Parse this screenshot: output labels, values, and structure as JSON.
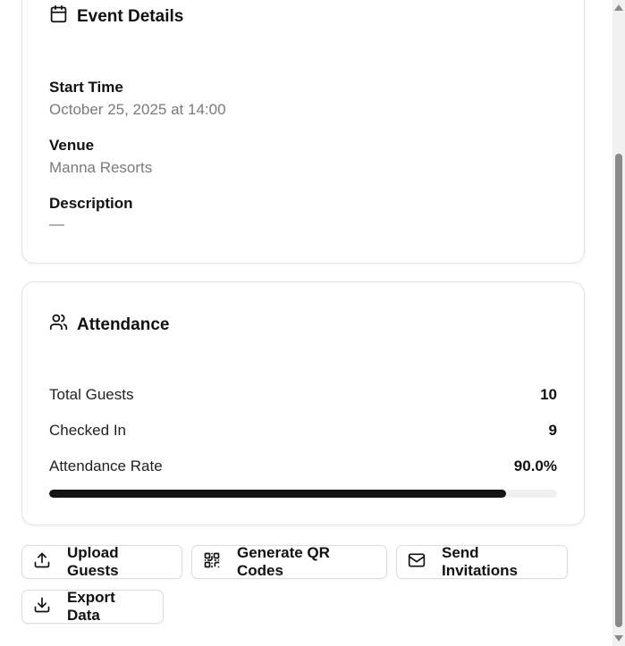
{
  "event_details": {
    "title": "Event Details",
    "icon": "calendar-icon",
    "start_time_label": "Start Time",
    "start_time_value": "October 25, 2025 at 14:00",
    "venue_label": "Venue",
    "venue_value": "Manna Resorts",
    "description_label": "Description",
    "description_value": "—"
  },
  "attendance": {
    "title": "Attendance",
    "icon": "users-icon",
    "total_guests_label": "Total Guests",
    "total_guests_value": "10",
    "checked_in_label": "Checked In",
    "checked_in_value": "9",
    "rate_label": "Attendance Rate",
    "rate_value": "90.0%",
    "rate_fraction": 0.9,
    "progress_color": "#141414"
  },
  "actions": {
    "upload_guests": {
      "label": "Upload Guests",
      "icon": "upload-icon"
    },
    "generate_qr": {
      "label": "Generate QR Codes",
      "icon": "qr-code-icon"
    },
    "send_invitations": {
      "label": "Send Invitations",
      "icon": "mail-icon"
    },
    "export_data": {
      "label": "Export Data",
      "icon": "download-icon"
    }
  }
}
